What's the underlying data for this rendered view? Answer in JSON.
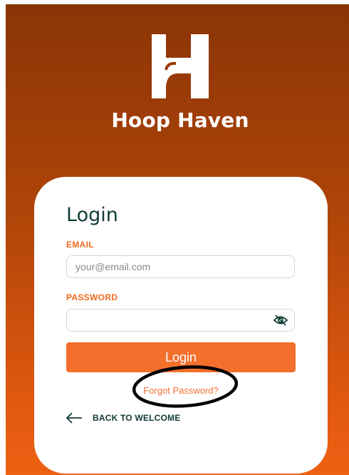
{
  "app": {
    "brand_name": "Hoop Haven",
    "logo_icon": "hoop-haven-h-logo",
    "colors": {
      "background_top": "#8a3406",
      "background_bottom": "#ee6113",
      "accent": "#f36f2b",
      "heading": "#123b37"
    }
  },
  "login_form": {
    "title": "Login",
    "email": {
      "label": "EMAIL",
      "placeholder": "your@email.com",
      "value": ""
    },
    "password": {
      "label": "PASSWORD",
      "value": "",
      "visibility_icon": "eye-off-icon"
    },
    "submit_label": "Login",
    "forgot_password_label": "Forgot Password?",
    "back_label": "BACK TO WELCOME",
    "back_icon": "arrow-left-icon"
  }
}
